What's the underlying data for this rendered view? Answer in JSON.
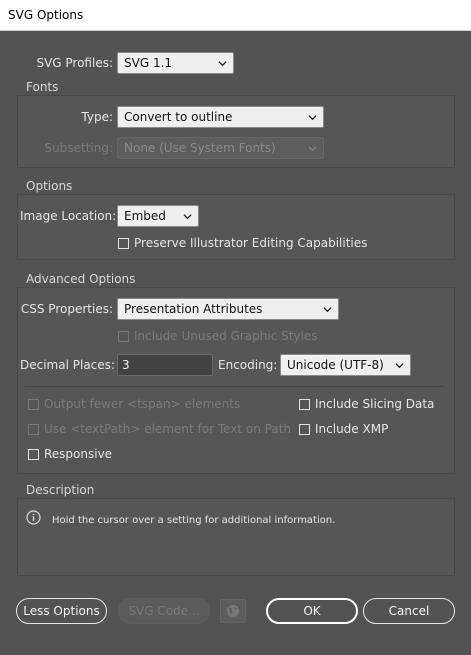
{
  "window": {
    "title": "SVG Options"
  },
  "profiles": {
    "label": "SVG Profiles:",
    "value": "SVG 1.1"
  },
  "fonts": {
    "section_title": "Fonts",
    "type_label": "Type:",
    "type_value": "Convert to outline",
    "subsetting_label": "Subsetting:",
    "subsetting_value": "None (Use System Fonts)"
  },
  "options": {
    "section_title": "Options",
    "image_location_label": "Image Location:",
    "image_location_value": "Embed",
    "preserve_label": "Preserve Illustrator Editing Capabilities",
    "preserve_checked": false
  },
  "advanced": {
    "section_title": "Advanced Options",
    "css_label": "CSS Properties:",
    "css_value": "Presentation Attributes",
    "unused_styles_label": "Include Unused Graphic Styles",
    "decimal_label": "Decimal Places:",
    "decimal_value": "3",
    "encoding_label": "Encoding:",
    "encoding_value": "Unicode (UTF-8)",
    "fewer_tspan_label": "Output fewer <tspan> elements",
    "textpath_label": "Use <textPath> element for Text on Path",
    "responsive_label": "Responsive",
    "slicing_label": "Include Slicing Data",
    "xmp_label": "Include XMP"
  },
  "description": {
    "section_title": "Description",
    "text": "Hold the cursor over a setting for additional information."
  },
  "buttons": {
    "less_options": "Less Options",
    "svg_code": "SVG Code...",
    "ok": "OK",
    "cancel": "Cancel"
  },
  "icons": {
    "info": "info-icon",
    "globe": "globe-icon",
    "dropdown": "chevron-down-icon"
  }
}
